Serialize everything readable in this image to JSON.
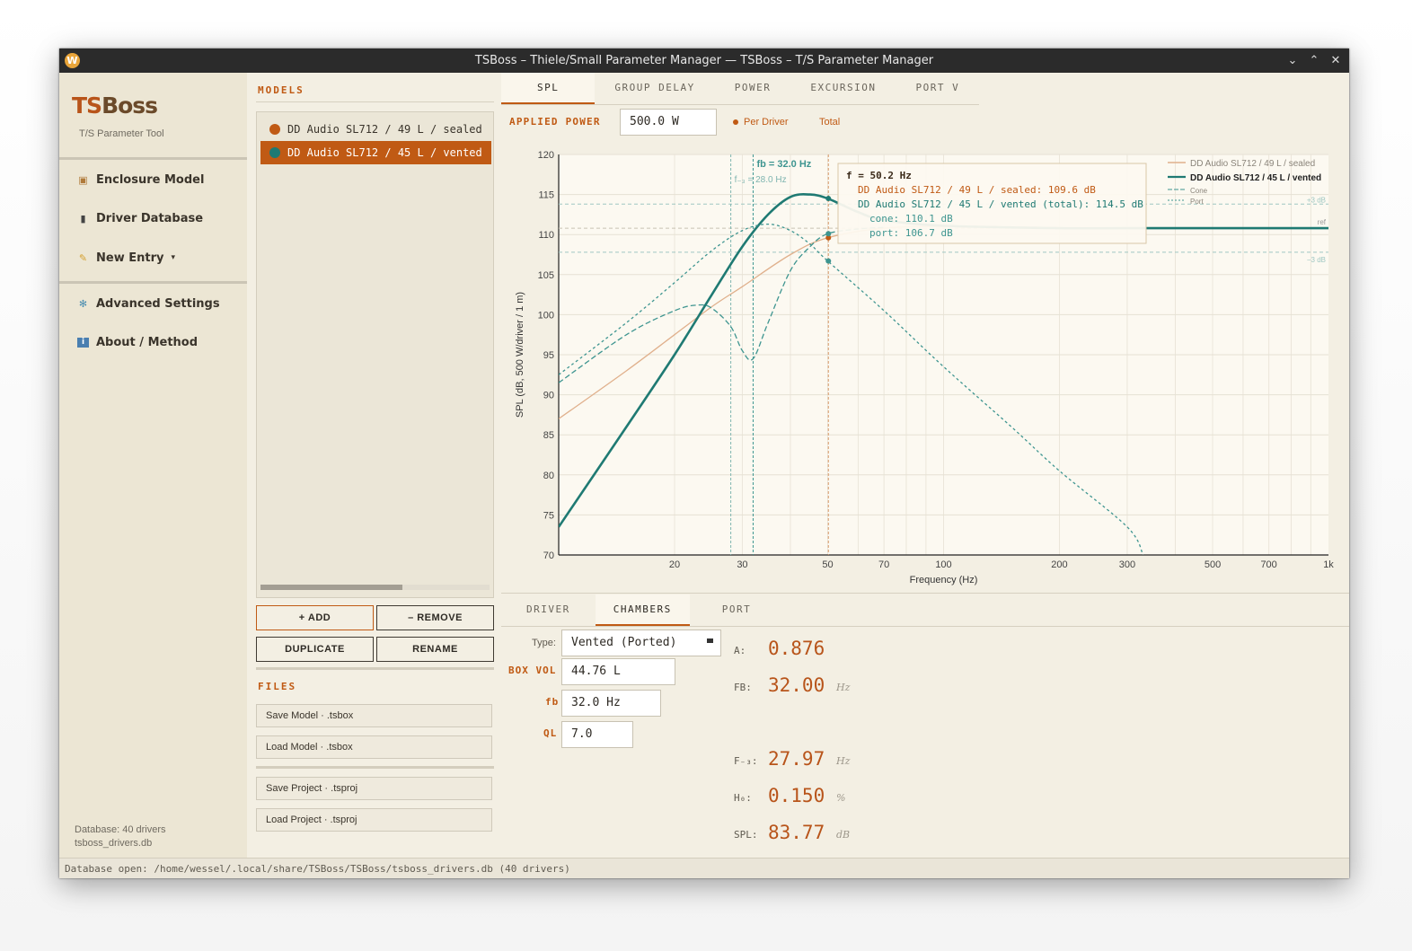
{
  "window": {
    "title": "TSBoss – Thiele/Small Parameter Manager — TSBoss – T/S Parameter Manager"
  },
  "sidebar": {
    "brand_ts": "TS",
    "brand_boss": "Boss",
    "subtitle": "T/S Parameter Tool",
    "items": [
      {
        "label": "Enclosure Model",
        "icon": "box-icon"
      },
      {
        "label": "Driver Database",
        "icon": "database-icon"
      },
      {
        "label": "New Entry",
        "icon": "pencil-icon",
        "dropdown": "▾"
      },
      {
        "label": "Advanced Settings",
        "icon": "gear-icon"
      },
      {
        "label": "About / Method",
        "icon": "info-icon"
      }
    ],
    "db_count": "Database: 40 drivers",
    "db_file": "tsboss_drivers.db"
  },
  "models": {
    "title": "MODELS",
    "items": [
      {
        "label": "DD Audio SL712 / 49 L / sealed",
        "color": "#c05a14",
        "selected": false
      },
      {
        "label": "DD Audio SL712 / 45 L / vented",
        "color": "#1f7a73",
        "selected": true
      }
    ],
    "add": "+ ADD",
    "remove": "– REMOVE",
    "duplicate": "DUPLICATE",
    "rename": "RENAME",
    "files_title": "FILES",
    "save_model": "Save Model  ·  .tsbox",
    "load_model": "Load Model  ·  .tsbox",
    "save_project": "Save Project  ·  .tsproj",
    "load_project": "Load Project  ·  .tsproj"
  },
  "top_tabs": [
    "SPL",
    "GROUP DELAY",
    "POWER",
    "EXCURSION",
    "PORT V"
  ],
  "applied_power": {
    "label": "APPLIED POWER",
    "value": "500.0 W",
    "per_driver": "Per Driver",
    "total": "Total"
  },
  "chart_data": {
    "type": "line",
    "xlabel": "Frequency (Hz)",
    "ylabel": "SPL (dB, 500 W/driver / 1 m)",
    "xscale": "log",
    "xlim": [
      10,
      1000
    ],
    "ylim": [
      70,
      120
    ],
    "x_ticks": [
      20,
      30,
      50,
      70,
      100,
      200,
      300,
      500,
      700,
      1000
    ],
    "x_tick_labels": [
      "20",
      "30",
      "50",
      "70",
      "100",
      "200",
      "300",
      "500",
      "700",
      "1k"
    ],
    "y_ticks": [
      70,
      75,
      80,
      85,
      90,
      95,
      100,
      105,
      110,
      115,
      120
    ],
    "grid": true,
    "legend_position": "top-right",
    "series": [
      {
        "name": "DD Audio SL712 / 49 L / sealed",
        "color": "#e0b08c",
        "style": "solid",
        "x": [
          10,
          15,
          20,
          25,
          30,
          40,
          50,
          70,
          100,
          200,
          300,
          500,
          1000
        ],
        "y": [
          87,
          93,
          97.5,
          101,
          103.5,
          107.5,
          109.6,
          110.8,
          111.0,
          110.8,
          110.8,
          110.8,
          110.8
        ]
      },
      {
        "name": "DD Audio SL712 / 45 L / vented",
        "color": "#1f7a73",
        "style": "solid",
        "x": [
          10,
          15,
          20,
          25,
          30,
          35,
          40,
          45,
          50,
          60,
          70,
          100,
          200,
          300,
          500,
          1000
        ],
        "y": [
          73.5,
          86,
          95,
          102.5,
          108.5,
          112.5,
          114.7,
          115.0,
          114.5,
          112.8,
          111.8,
          111.1,
          110.8,
          110.8,
          110.8,
          110.8
        ]
      },
      {
        "name": "Cone",
        "color": "#3e9590",
        "style": "dashed",
        "x": [
          10,
          15,
          20,
          23,
          25,
          28,
          30,
          32,
          35,
          40,
          45,
          50,
          60,
          70
        ],
        "y": [
          91.5,
          97.5,
          100.5,
          101.2,
          100.8,
          98.5,
          95.5,
          94.5,
          99,
          105.5,
          108.5,
          110.1,
          110.7,
          110.9
        ]
      },
      {
        "name": "Port",
        "color": "#3e9590",
        "style": "dotted",
        "x": [
          10,
          15,
          20,
          25,
          30,
          35,
          40,
          45,
          50,
          70,
          100,
          150,
          200,
          300,
          330
        ],
        "y": [
          92.5,
          99,
          104,
          108,
          110.5,
          111.3,
          110.5,
          108.8,
          106.7,
          100.5,
          93.5,
          86,
          80.5,
          73.5,
          70
        ]
      }
    ],
    "annotations": {
      "fb": {
        "label": "fb = 32.0 Hz",
        "x": 32.0
      },
      "f3": {
        "label": "f₋₃ = 28.0 Hz",
        "x": 28.0
      },
      "cursor_x": 50.2,
      "ref_label": "ref",
      "plus3_label": "+3 dB",
      "minus3_label": "−3 dB",
      "ref_y": 110.8
    },
    "tooltip": {
      "title": "f = 50.2 Hz",
      "line1": "DD Audio SL712 / 49 L / sealed: 109.6 dB",
      "line2": "DD Audio SL712 / 45 L / vented (total): 114.5 dB",
      "line3": "cone: 110.1 dB",
      "line4": "port: 106.7 dB"
    }
  },
  "bottom_tabs": [
    "DRIVER",
    "CHAMBERS",
    "PORT"
  ],
  "chambers": {
    "type_label": "Type:",
    "type_value": "Vented (Ported)",
    "boxvol_label": "BOX VOL",
    "boxvol_value": "44.76 L",
    "fb_label": "fb",
    "fb_value": "32.0 Hz",
    "ql_label": "QL",
    "ql_value": "7.0"
  },
  "results": [
    {
      "label": "A:",
      "value": "0.876",
      "unit": ""
    },
    {
      "label": "FB:",
      "value": "32.00",
      "unit": "Hz"
    },
    {
      "label": "F₋₃:",
      "value": "27.97",
      "unit": "Hz"
    },
    {
      "label": "H₀:",
      "value": "0.150",
      "unit": "%"
    },
    {
      "label": "SPL:",
      "value": "83.77",
      "unit": "dB"
    }
  ],
  "status": "Database open: /home/wessel/.local/share/TSBoss/TSBoss/tsboss_drivers.db  (40 drivers)"
}
